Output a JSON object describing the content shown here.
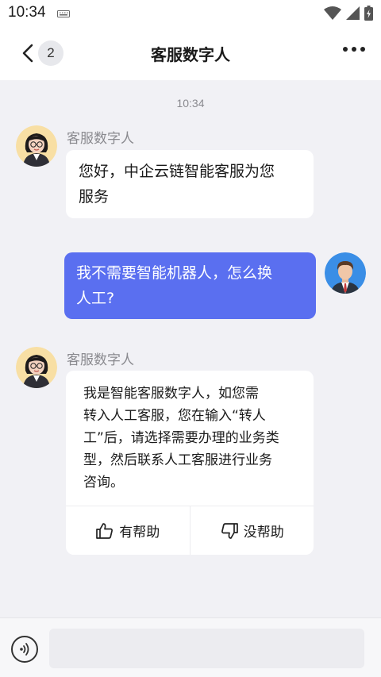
{
  "status_bar": {
    "time": "10:34"
  },
  "nav": {
    "badge_count": "2",
    "title": "客服数字人"
  },
  "conversation": {
    "timestamp": "10:34",
    "messages": [
      {
        "sender": "客服数字人",
        "lines": [
          "您好，中企云链智能客服为您",
          "服务"
        ]
      },
      {
        "lines": [
          "我不需要智能机器人，怎么换",
          "人工?"
        ]
      },
      {
        "sender": "客服数字人",
        "lines": [
          "我是智能客服数字人，如您需",
          "转入人工客服，您在输入“转人",
          "工”后，请选择需要办理的业务类",
          "型，然后联系人工客服进行业务",
          "咨询。"
        ]
      }
    ],
    "feedback": {
      "helpful": "有帮助",
      "not_helpful": "没帮助"
    }
  },
  "input": {
    "placeholder": ""
  },
  "colors": {
    "user_bubble": "#5a6ff0",
    "background": "#f1f1f5"
  }
}
